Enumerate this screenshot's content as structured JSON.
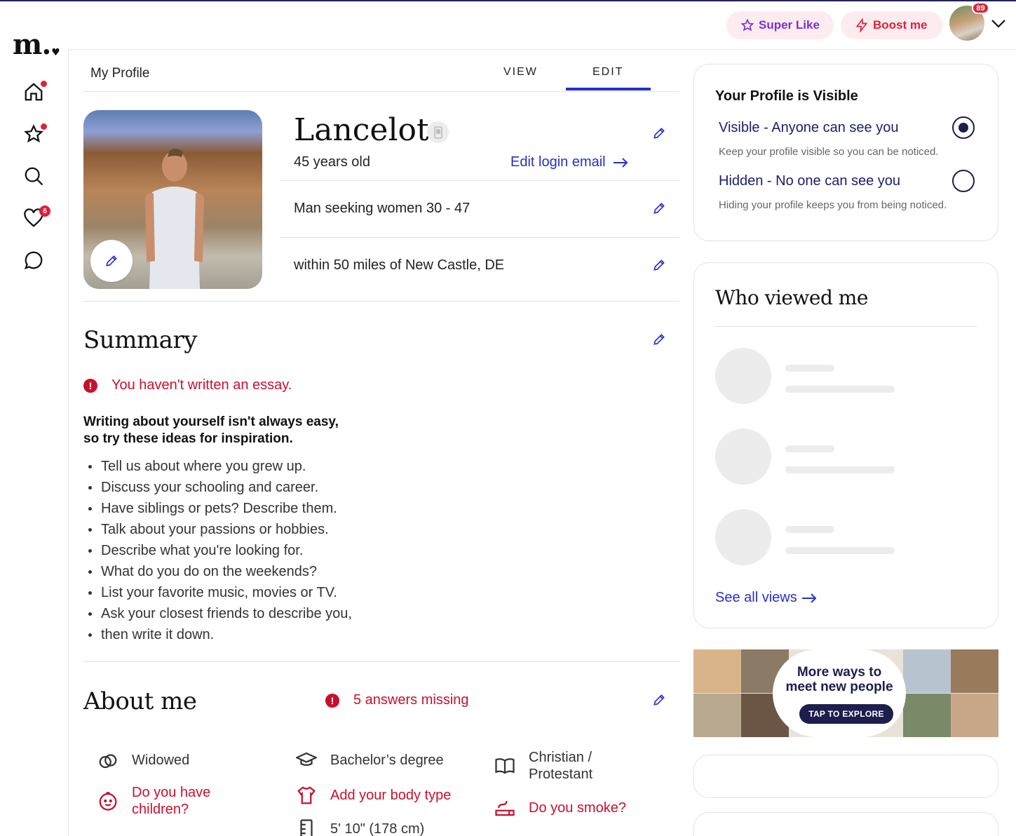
{
  "brand": {
    "logo_text": "m.",
    "accent": "#2630c9",
    "alert": "#c8102e"
  },
  "header": {
    "super_like_label": "Super Like",
    "boost_label": "Boost me",
    "avatar_badge": "89"
  },
  "sidebar": {
    "items": [
      {
        "name": "home",
        "dot": true
      },
      {
        "name": "favorites",
        "dot": true
      },
      {
        "name": "search",
        "dot": false
      },
      {
        "name": "likes",
        "badge": "6"
      },
      {
        "name": "messages",
        "dot": false
      }
    ]
  },
  "profile_header": {
    "title": "My Profile",
    "tabs": [
      {
        "label": "VIEW"
      },
      {
        "label": "EDIT",
        "active": true
      }
    ]
  },
  "profile": {
    "name": "Lancelot",
    "age": "45 years old",
    "edit_email_label": "Edit login email",
    "seeking": "Man seeking women 30 - 47",
    "location": "within 50 miles of New Castle, DE"
  },
  "summary": {
    "title": "Summary",
    "warning": "You haven't written an essay.",
    "tips_heading_line1": "Writing about yourself isn't always easy,",
    "tips_heading_line2": "so try these ideas for inspiration.",
    "tips": [
      "Tell us about where you grew up.",
      "Discuss your schooling and career.",
      "Have siblings or pets? Describe them.",
      "Talk about your passions or hobbies.",
      "Describe what you're looking for.",
      "What do you do on the weekends?",
      "List your favorite music, movies or TV.",
      "Ask your closest friends to describe you,",
      "then write it down."
    ]
  },
  "about": {
    "title": "About me",
    "warning": "5 answers missing",
    "marital": "Widowed",
    "education": "Bachelor’s degree",
    "religion_line1": "Christian /",
    "religion_line2": "Protestant",
    "children_line1": "Do you have",
    "children_line2": "children?",
    "body_type": "Add your body type",
    "smoke": "Do you smoke?",
    "height": "5' 10\" (178 cm)"
  },
  "visibility": {
    "title": "Your Profile is Visible",
    "visible_label": "Visible - Anyone can see you",
    "visible_sub": "Keep your profile visible so you can be noticed.",
    "hidden_label": "Hidden - No one can see you",
    "hidden_sub": "Hiding your profile keeps you from being noticed.",
    "selected": "visible"
  },
  "viewers": {
    "title": "Who viewed me",
    "see_all_label": "See all views"
  },
  "banner": {
    "line1": "More ways to",
    "line2": "meet new people",
    "button_label": "TAP TO EXPLORE"
  }
}
